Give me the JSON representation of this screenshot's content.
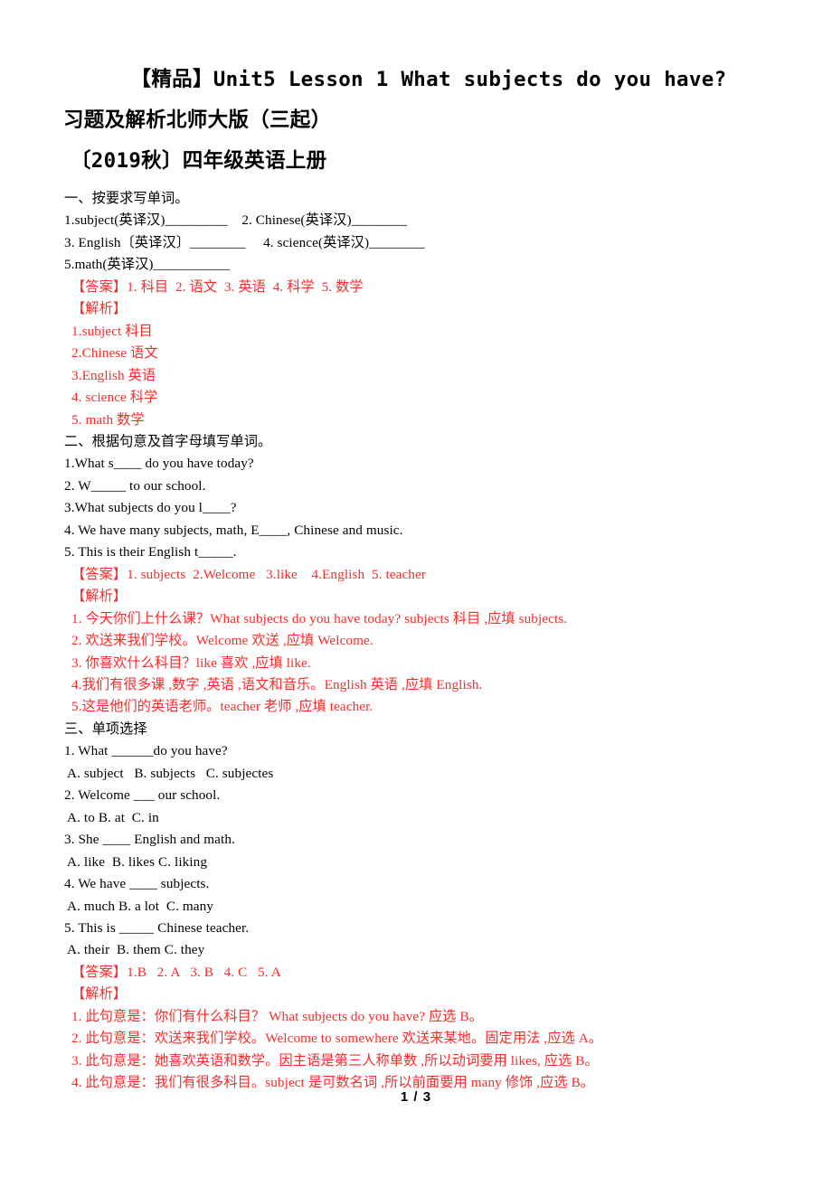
{
  "document": {
    "title_lines": [
      "【精品】Unit5 Lesson 1 What subjects do you have?",
      "习题及解析北师大版（三起）",
      "〔2019秋〕四年级英语上册"
    ],
    "footer": "1 / 3",
    "answer_color": "#fb2b2b",
    "text_color": "#000000"
  },
  "sections": [
    {
      "heading": "一、按要求写单词。",
      "questions": [
        "1.subject(英译汉)_________    2. Chinese(英译汉)________",
        "3. English〔英译汉〕________     4. science(英译汉)________",
        "5.math(英译汉)___________"
      ],
      "answer_label": "【答案】",
      "answer_text": "1. 科目  2. 语文  3. 英语  4. 科学  5. 数学",
      "analysis_label": "【解析】",
      "analysis_lines": [
        "1.subject 科目",
        "2.Chinese 语文",
        "3.English 英语",
        "4. science 科学",
        "5. math 数学"
      ]
    },
    {
      "heading": "二、根据句意及首字母填写单词。",
      "questions": [
        "1.What s____ do you have today?",
        "2. W_____ to our school.",
        "3.What subjects do you l____?",
        "4. We have many subjects, math, E____, Chinese and music.",
        "5. This is their English t_____."
      ],
      "answer_label": "【答案】",
      "answer_text": "1. subjects  2.Welcome   3.like    4.English  5. teacher",
      "analysis_label": "【解析】",
      "analysis_lines": [
        "1. 今天你们上什么课？What subjects do you have today? subjects 科目 ,应填 subjects.",
        "2. 欢送来我们学校。Welcome 欢送 ,应填 Welcome.",
        "3. 你喜欢什么科目？like 喜欢 ,应填 like.",
        "4.我们有很多课 ,数字 ,英语 ,语文和音乐。English 英语 ,应填 English.",
        "5.这是他们的英语老师。teacher 老师 ,应填 teacher."
      ]
    },
    {
      "heading": "三、单项选择",
      "questions": [
        "1. What ______do you have?",
        " A. subject   B. subjects   C. subjectes",
        "2. Welcome ___ our school.",
        " A. to B. at  C. in",
        "3. She ____ English and math.",
        " A. like  B. likes C. liking",
        "4. We have ____ subjects.",
        " A. much B. a lot  C. many",
        "5. This is _____ Chinese teacher.",
        " A. their  B. them C. they"
      ],
      "answer_label": "【答案】",
      "answer_text": "1.B   2. A   3. B   4. C   5. A",
      "analysis_label": "【解析】",
      "analysis_lines": [
        "1. 此句意是：你们有什么科目？ What subjects do you have? 应选 B。",
        "2. 此句意是：欢送来我们学校。Welcome to somewhere 欢送来某地。固定用法 ,应选 A。",
        "3. 此句意是：她喜欢英语和数学。因主语是第三人称单数 ,所以动词要用 likes, 应选 B。",
        "4. 此句意是：我们有很多科目。subject 是可数名词 ,所以前面要用 many 修饰 ,应选 B。"
      ]
    }
  ]
}
